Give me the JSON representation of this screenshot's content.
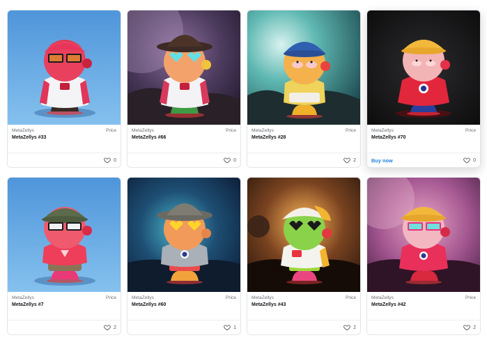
{
  "labels": {
    "price": "Price",
    "buy_now": "Buy now"
  },
  "cards": [
    {
      "collection": "MetaZellys",
      "name": "MetaZellys #33",
      "likes": "0"
    },
    {
      "collection": "MetaZellys",
      "name": "MetaZellys #66",
      "likes": "0"
    },
    {
      "collection": "MetaZellys",
      "name": "MetaZellys #28",
      "likes": "2"
    },
    {
      "collection": "MetaZellys",
      "name": "MetaZellys #70",
      "likes": "0"
    },
    {
      "collection": "MetaZellys",
      "name": "MetaZellys #7",
      "likes": "2"
    },
    {
      "collection": "MetaZellys",
      "name": "MetaZellys #60",
      "likes": "1"
    },
    {
      "collection": "MetaZellys",
      "name": "MetaZellys #43",
      "likes": "2"
    },
    {
      "collection": "MetaZellys",
      "name": "MetaZellys #42",
      "likes": "2"
    }
  ],
  "colors": {
    "link": "#2081e2",
    "border": "#e3e5e8"
  },
  "icons": {
    "like": "heart-outline-icon"
  }
}
